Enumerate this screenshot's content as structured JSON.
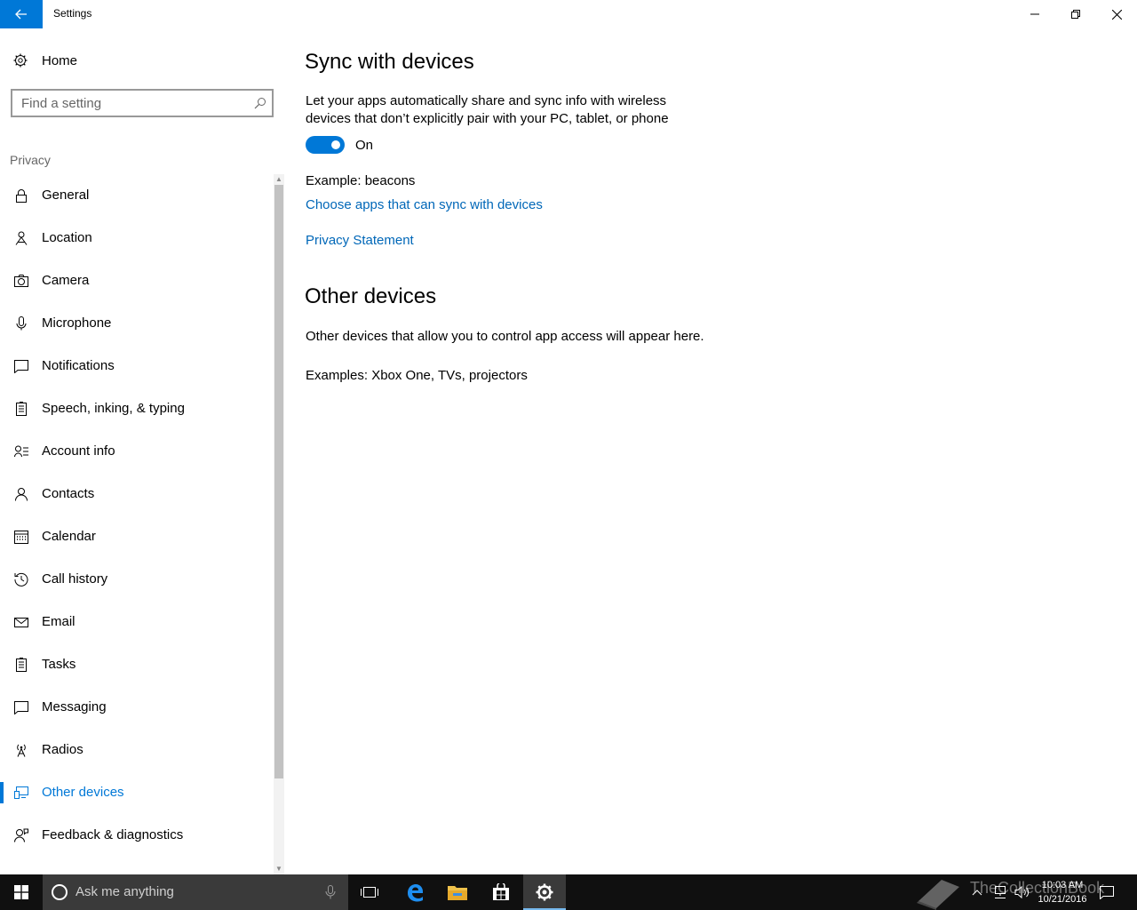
{
  "window": {
    "title": "Settings"
  },
  "sidebar": {
    "home_label": "Home",
    "search_placeholder": "Find a setting",
    "section_label": "Privacy",
    "items": [
      {
        "label": "General",
        "icon": "lock-icon"
      },
      {
        "label": "Location",
        "icon": "location-icon"
      },
      {
        "label": "Camera",
        "icon": "camera-icon"
      },
      {
        "label": "Microphone",
        "icon": "microphone-icon"
      },
      {
        "label": "Notifications",
        "icon": "notifications-icon"
      },
      {
        "label": "Speech, inking, & typing",
        "icon": "speech-icon"
      },
      {
        "label": "Account info",
        "icon": "account-info-icon"
      },
      {
        "label": "Contacts",
        "icon": "contacts-icon"
      },
      {
        "label": "Calendar",
        "icon": "calendar-icon"
      },
      {
        "label": "Call history",
        "icon": "history-icon"
      },
      {
        "label": "Email",
        "icon": "email-icon"
      },
      {
        "label": "Tasks",
        "icon": "tasks-icon"
      },
      {
        "label": "Messaging",
        "icon": "messaging-icon"
      },
      {
        "label": "Radios",
        "icon": "radio-icon"
      },
      {
        "label": "Other devices",
        "icon": "devices-icon",
        "active": true
      },
      {
        "label": "Feedback & diagnostics",
        "icon": "feedback-icon"
      }
    ]
  },
  "main": {
    "sync_heading": "Sync with devices",
    "sync_description_line1": "Let your apps automatically share and sync info with wireless",
    "sync_description_line2": "devices that don’t explicitly pair with your PC, tablet, or phone",
    "toggle_state": "On",
    "example_text": "Example: beacons",
    "choose_apps_link": "Choose apps that can sync with devices",
    "privacy_link": "Privacy Statement",
    "other_heading": "Other devices",
    "other_description": "Other devices that allow you to control app access will appear here.",
    "other_examples": "Examples: Xbox One, TVs, projectors"
  },
  "taskbar": {
    "search_placeholder": "Ask me anything",
    "time": "10:03 AM",
    "date": "10/21/2016",
    "watermark": "TheCollectionBook"
  },
  "colors": {
    "accent": "#0078d7",
    "link": "#0067b8",
    "taskbar": "#101010"
  }
}
